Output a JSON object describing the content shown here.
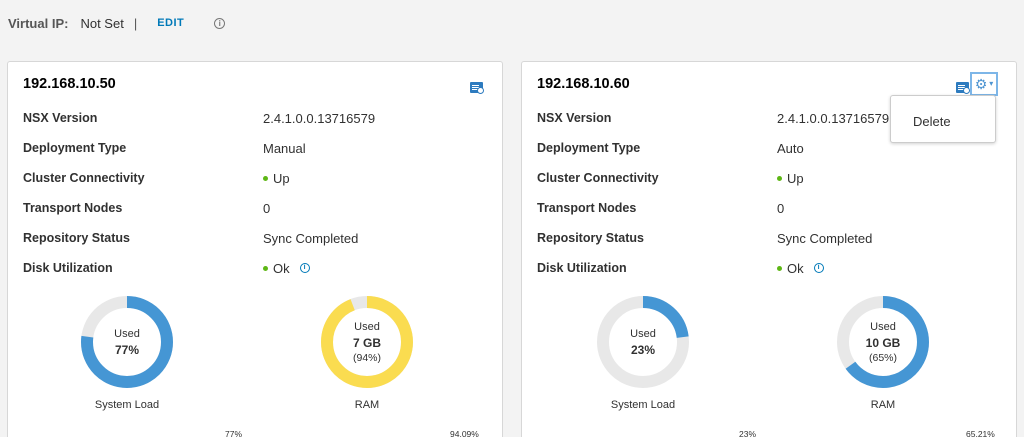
{
  "header": {
    "label": "Virtual IP:",
    "value": "Not Set",
    "separator": "|",
    "edit_label": "EDIT",
    "info_glyph": "i"
  },
  "row_labels": [
    "NSX Version",
    "Deployment Type",
    "Cluster Connectivity",
    "Transport Nodes",
    "Repository Status",
    "Disk Utilization"
  ],
  "colors": {
    "accent": "#0079b8",
    "ring_blue": "#4596d4",
    "ring_yellow": "#fadc50",
    "ring_track": "#e8e8e8",
    "status_green": "#5eb715"
  },
  "nodes": [
    {
      "ip": "192.168.10.50",
      "nsx_version": "2.4.1.0.0.13716579",
      "deployment_type": "Manual",
      "connectivity": "Up",
      "transport_nodes": "0",
      "repository_status": "Sync Completed",
      "disk_utilization": "Ok",
      "system_load": {
        "used_label": "Used",
        "value": "77%",
        "fraction": 0.77,
        "label": "System Load",
        "bottom_value": "77%"
      },
      "ram": {
        "used_label": "Used",
        "value": "7 GB",
        "percent": "(94%)",
        "fraction": 0.94,
        "label": "RAM",
        "bottom_value": "94.09%"
      }
    },
    {
      "ip": "192.168.10.60",
      "nsx_version": "2.4.1.0.0.13716579",
      "deployment_type": "Auto",
      "connectivity": "Up",
      "transport_nodes": "0",
      "repository_status": "Sync Completed",
      "disk_utilization": "Ok",
      "system_load": {
        "used_label": "Used",
        "value": "23%",
        "fraction": 0.23,
        "label": "System Load",
        "bottom_value": "23%"
      },
      "ram": {
        "used_label": "Used",
        "value": "10 GB",
        "percent": "(65%)",
        "fraction": 0.65,
        "label": "RAM",
        "bottom_value": "65.21%"
      }
    }
  ],
  "menu": {
    "delete_label": "Delete"
  }
}
